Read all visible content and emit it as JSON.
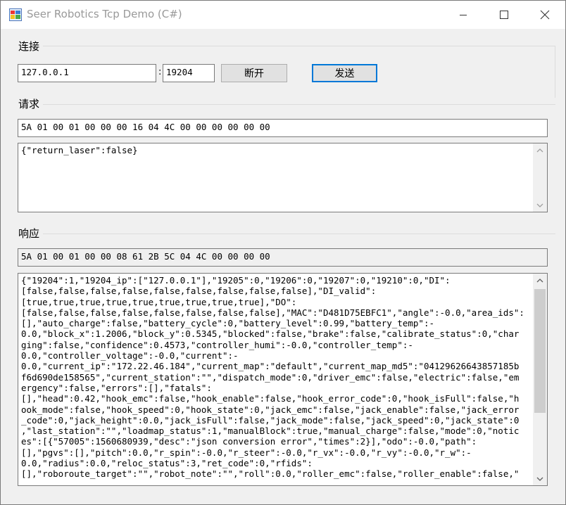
{
  "window": {
    "title": "Seer Robotics Tcp Demo (C#)",
    "icons": {
      "app": "app-icon",
      "minimize": "minimize-icon",
      "maximize": "maximize-icon",
      "close": "close-icon"
    }
  },
  "connect": {
    "group_label": "连接",
    "ip_value": "127.0.0.1",
    "separator": ":",
    "port_value": "19204",
    "disconnect_label": "断开",
    "send_label": "发送"
  },
  "request": {
    "group_label": "请求",
    "header_hex": "5A 01 00 01 00 00 00 16 04 4C 00 00 00 00 00 00",
    "body": "{\"return_laser\":false}",
    "scroll_up_icon": "chevron-up-icon",
    "scroll_down_icon": "chevron-down-icon"
  },
  "response": {
    "group_label": "响应",
    "header_hex": "5A 01 00 01 00 00 08 61 2B 5C 04 4C 00 00 00 00",
    "body_lines": [
      "{\"19204\":1,\"19204_ip\":[\"127.0.0.1\"],\"19205\":0,\"19206\":0,\"19207\":0,\"19210\":0,\"DI\":",
      "[false,false,false,false,false,false,false,false,false],\"DI_valid\":",
      "[true,true,true,true,true,true,true,true,true],\"DO\":",
      "[false,false,false,false,false,false,false,false],\"MAC\":\"D481D75EBFC1\",\"angle\":-0.0,\"area_ids\":",
      "[],\"auto_charge\":false,\"battery_cycle\":0,\"battery_level\":0.99,\"battery_temp\":-",
      "0.0,\"block_x\":1.2006,\"block_y\":0.5345,\"blocked\":false,\"brake\":false,\"calibrate_status\":0,\"char",
      "ging\":false,\"confidence\":0.4573,\"controller_humi\":-0.0,\"controller_temp\":-",
      "0.0,\"controller_voltage\":-0.0,\"current\":-",
      "0.0,\"current_ip\":\"172.22.46.184\",\"current_map\":\"default\",\"current_map_md5\":\"04129626643857185b",
      "f6d690de158565\",\"current_station\":\"\",\"dispatch_mode\":0,\"driver_emc\":false,\"electric\":false,\"em",
      "ergency\":false,\"errors\":[],\"fatals\":",
      "[],\"head\":0.42,\"hook_emc\":false,\"hook_enable\":false,\"hook_error_code\":0,\"hook_isFull\":false,\"h",
      "ook_mode\":false,\"hook_speed\":0,\"hook_state\":0,\"jack_emc\":false,\"jack_enable\":false,\"jack_error",
      "_code\":0,\"jack_height\":0.0,\"jack_isFull\":false,\"jack_mode\":false,\"jack_speed\":0,\"jack_state\":0",
      ",\"last_station\":\"\",\"loadmap_status\":1,\"manualBlock\":true,\"manual_charge\":false,\"mode\":0,\"notic",
      "es\":[{\"57005\":1560680939,\"desc\":\"json conversion error\",\"times\":2}],\"odo\":-0.0,\"path\":",
      "[],\"pgvs\":[],\"pitch\":0.0,\"r_spin\":-0.0,\"r_steer\":-0.0,\"r_vx\":-0.0,\"r_vy\":-0.0,\"r_w\":-",
      "0.0,\"radius\":0.0,\"reloc_status\":3,\"ret_code\":0,\"rfids\":",
      "[],\"roboroute_target\":\"\",\"robot_note\":\"\",\"roll\":0.0,\"roller_emc\":false,\"roller_enable\":false,\""
    ],
    "scroll_up_icon": "chevron-up-icon",
    "scroll_down_icon": "chevron-down-icon"
  }
}
